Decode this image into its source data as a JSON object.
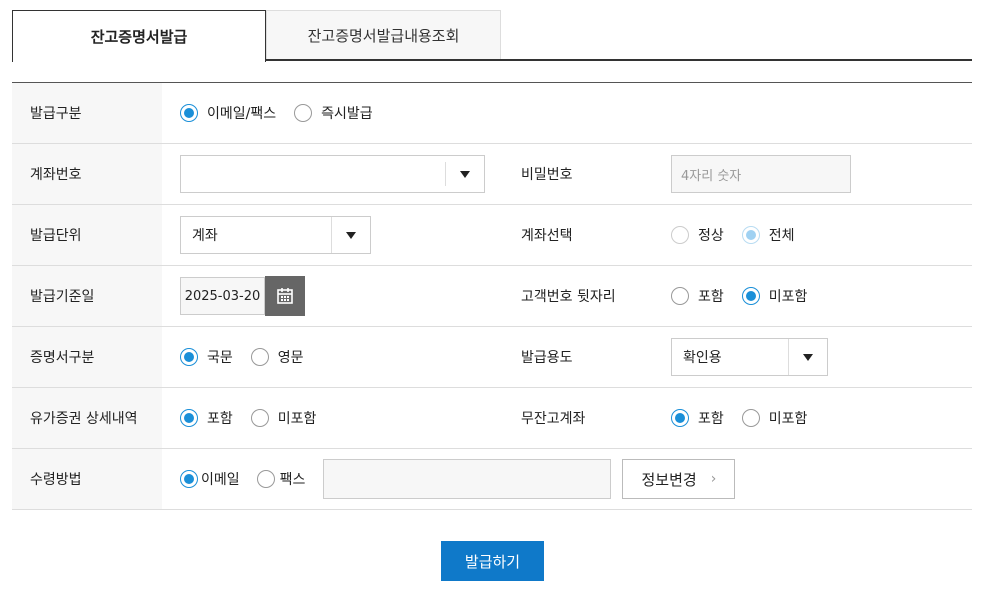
{
  "tabs": {
    "active": "잔고증명서발급",
    "inactive": "잔고증명서발급내용조회"
  },
  "rows": {
    "issue_type": {
      "label": "발급구분",
      "opt1": "이메일/팩스",
      "opt2": "즉시발급"
    },
    "account_no": {
      "label": "계좌번호",
      "value": ""
    },
    "password": {
      "label": "비밀번호",
      "placeholder": "4자리 숫자"
    },
    "issue_unit": {
      "label": "발급단위",
      "value": "계좌"
    },
    "account_select": {
      "label": "계좌선택",
      "opt1": "정상",
      "opt2": "전체"
    },
    "base_date": {
      "label": "발급기준일",
      "value": "2025-03-20"
    },
    "cust_suffix": {
      "label": "고객번호 뒷자리",
      "opt1": "포함",
      "opt2": "미포함"
    },
    "cert_type": {
      "label": "증명서구분",
      "opt1": "국문",
      "opt2": "영문"
    },
    "purpose": {
      "label": "발급용도",
      "value": "확인용"
    },
    "securities_detail": {
      "label": "유가증권 상세내역",
      "opt1": "포함",
      "opt2": "미포함"
    },
    "zero_balance": {
      "label": "무잔고계좌",
      "opt1": "포함",
      "opt2": "미포함"
    },
    "receive_method": {
      "label": "수령방법",
      "opt1": "이메일",
      "opt2": "팩스",
      "info_button": "정보변경"
    }
  },
  "submit_label": "발급하기",
  "icons": {
    "calendar": "calendar-icon",
    "dropdown": "chevron-down-icon",
    "chevron": "chevron-right-icon"
  },
  "colors": {
    "accent": "#1a8fd8",
    "button": "#0f79c9"
  }
}
